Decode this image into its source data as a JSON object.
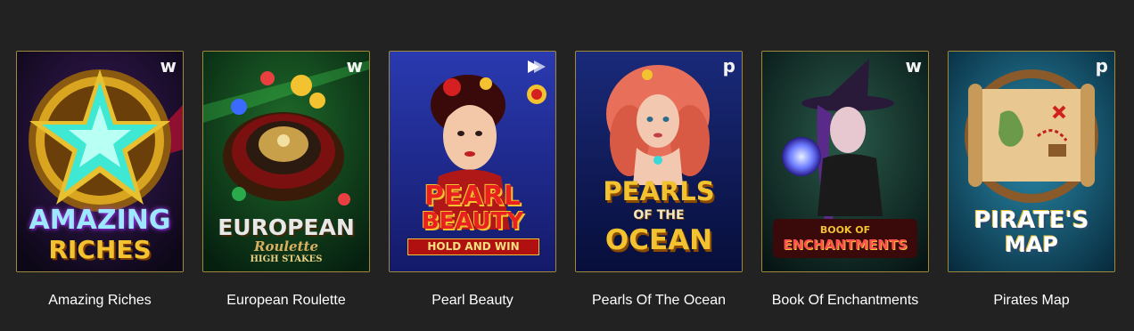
{
  "games": [
    {
      "title": "Amazing Riches",
      "provider_badge": "w",
      "logo": [
        "AMAZING",
        "RICHES"
      ],
      "colors": {
        "bg": "#1a0f2e",
        "accent": "#d9a520",
        "gem": "#3ee8d2"
      }
    },
    {
      "title": "European Roulette",
      "provider_badge": "w",
      "logo": [
        "EUROPEAN",
        "Roulette",
        "HIGH STAKES"
      ],
      "colors": {
        "bg": "#0f3a1a",
        "accent": "#c9a04a",
        "gem": "#7a1010"
      }
    },
    {
      "title": "Pearl Beauty",
      "provider_badge": "",
      "logo": [
        "PEARL",
        "BEAUTY",
        "HOLD AND WIN"
      ],
      "colors": {
        "bg": "#1e2a8a",
        "accent": "#d42020",
        "gem": "#f2c230"
      }
    },
    {
      "title": "Pearls Of The Ocean",
      "provider_badge": "p",
      "logo": [
        "PEARLS",
        "OF THE",
        "OCEAN"
      ],
      "colors": {
        "bg": "#0c1a5a",
        "accent": "#f2c230",
        "gem": "#e8705a"
      }
    },
    {
      "title": "Book Of Enchantments",
      "provider_badge": "w",
      "logo": [
        "BOOK OF",
        "ENCHANTMENTS"
      ],
      "colors": {
        "bg": "#0f2a2a",
        "accent": "#c82828",
        "gem": "#6a7aff"
      }
    },
    {
      "title": "Pirates Map",
      "provider_badge": "p",
      "logo": [
        "PIRATE'S",
        "MAP"
      ],
      "colors": {
        "bg": "#0a4a6a",
        "accent": "#f2c230",
        "gem": "#c89a5a"
      }
    }
  ]
}
